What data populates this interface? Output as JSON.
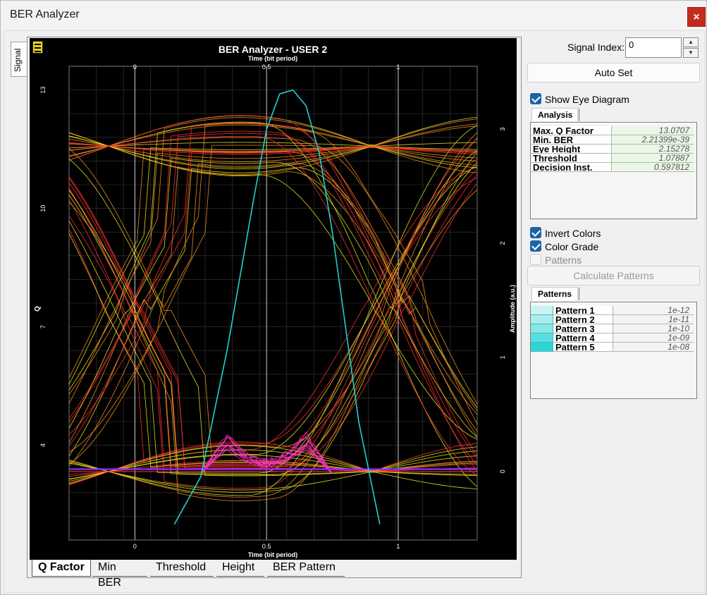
{
  "window": {
    "title": "BER Analyzer",
    "close_glyph": "×"
  },
  "side_tab": {
    "label": "Signal"
  },
  "plot": {
    "title": "BER Analyzer - USER 2",
    "x_axis_label": "Time (bit period)",
    "y_left_label": "Q",
    "y_right_label": "Amplitude (a.u.)",
    "x_ticks": [
      "0",
      "0.5",
      "1"
    ],
    "y_left_ticks": [
      "13",
      "10",
      "7",
      "4"
    ],
    "y_right_ticks": [
      "3",
      "2",
      "1",
      "0"
    ]
  },
  "chart_data": {
    "type": "line",
    "title": "BER Analyzer - USER 2",
    "xlabel": "Time (bit period)",
    "ylabel": "Q",
    "y2label": "Amplitude (a.u.)",
    "xlim": [
      -0.25,
      1.3
    ],
    "ylim": [
      1.6,
      13.6
    ],
    "y2lim": [
      -0.6,
      3.55
    ],
    "x_ticks": [
      0,
      0.5,
      1
    ],
    "y_ticks": [
      13,
      10,
      7,
      4
    ],
    "y2_ticks": [
      3,
      2,
      1,
      0
    ],
    "grid": true,
    "series": [
      {
        "color": "#20d0d0",
        "x": [
          0.15,
          0.25,
          0.35,
          0.45,
          0.5,
          0.55,
          0.6,
          0.65,
          0.7,
          0.75,
          0.85,
          0.93
        ],
        "values": [
          2.0,
          3.2,
          6.4,
          10.2,
          12.0,
          12.9,
          13.0,
          12.6,
          11.4,
          9.4,
          4.6,
          2.0
        ]
      }
    ],
    "eye_diagram": {
      "colors": [
        "#e8e020",
        "#f09020",
        "#ff3030",
        "#ff30c0",
        "#8030ff"
      ],
      "amplitude_levels": [
        0,
        2.85
      ]
    }
  },
  "bottom_tabs": [
    "Q Factor",
    "Min BER",
    "Threshold",
    "Height",
    "BER Pattern"
  ],
  "right_panel": {
    "signal_index_label": "Signal Index:",
    "signal_index_value": "0",
    "auto_set_label": "Auto Set",
    "show_eye_label": "Show Eye Diagram",
    "analysis_tab": "Analysis",
    "analysis_rows": [
      {
        "name": "Max. Q Factor",
        "value": "13.0707"
      },
      {
        "name": "Min. BER",
        "value": "2.21399e-39"
      },
      {
        "name": "Eye Height",
        "value": "2.15278"
      },
      {
        "name": "Threshold",
        "value": "1.07887"
      },
      {
        "name": "Decision Inst.",
        "value": "0.597812"
      }
    ],
    "invert_colors_label": "Invert Colors",
    "color_grade_label": "Color Grade",
    "patterns_label": "Patterns",
    "calculate_patterns_label": "Calculate Patterns",
    "patterns_tab": "Patterns",
    "pattern_rows": [
      {
        "name": "Pattern 1",
        "value": "1e-12",
        "color": "#c8f4f4"
      },
      {
        "name": "Pattern 2",
        "value": "1e-11",
        "color": "#a8eeee"
      },
      {
        "name": "Pattern 3",
        "value": "1e-10",
        "color": "#86e8e8"
      },
      {
        "name": "Pattern 4",
        "value": "1e-09",
        "color": "#58e0e0"
      },
      {
        "name": "Pattern 5",
        "value": "1e-08",
        "color": "#2ad6d6"
      }
    ],
    "checkbox_states": {
      "show_eye": true,
      "invert_colors": true,
      "color_grade": true,
      "patterns": false
    }
  }
}
